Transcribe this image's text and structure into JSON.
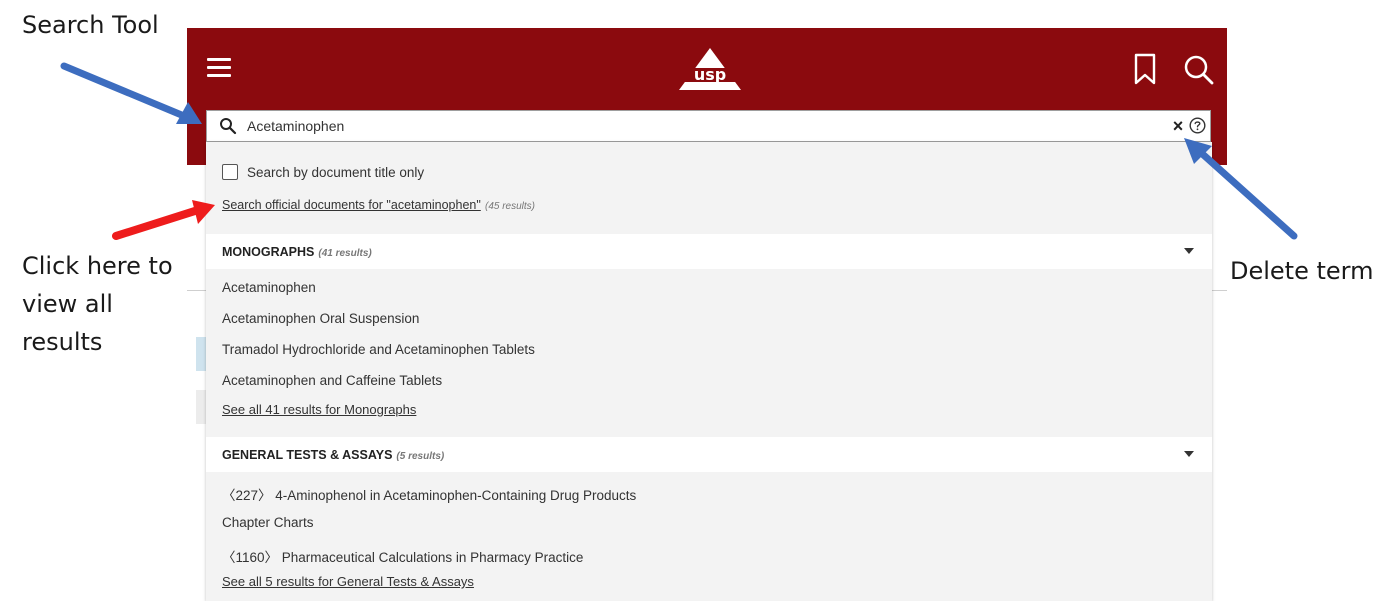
{
  "annotations": {
    "search_tool": "Search Tool",
    "click_here": "Click here to view all results",
    "delete_term": "Delete term"
  },
  "header": {
    "logo_text": "usp",
    "brand_color": "#8b0a0e"
  },
  "search": {
    "value": "Acetaminophen"
  },
  "dropdown": {
    "title_only_label": "Search by document title only",
    "official_link": "Search official documents for \"acetaminophen\"",
    "official_count": "(45 results)",
    "sections": [
      {
        "title": "MONOGRAPHS",
        "count": "(41 results)",
        "items": [
          "Acetaminophen",
          "Acetaminophen Oral Suspension",
          "Tramadol Hydrochloride and Acetaminophen Tablets",
          "Acetaminophen and Caffeine Tablets"
        ],
        "see_all": "See all 41 results for Monographs"
      },
      {
        "title": "GENERAL TESTS & ASSAYS",
        "count": "(5 results)",
        "items": [
          "〈227〉 4-Aminophenol in Acetaminophen-Containing Drug Products",
          "Chapter Charts",
          "〈1160〉 Pharmaceutical Calculations in Pharmacy Practice"
        ],
        "see_all": "See all 5 results for General Tests & Assays"
      }
    ]
  },
  "colors": {
    "arrow_blue": "#3d6dbf",
    "arrow_red": "#ee1c1c"
  }
}
